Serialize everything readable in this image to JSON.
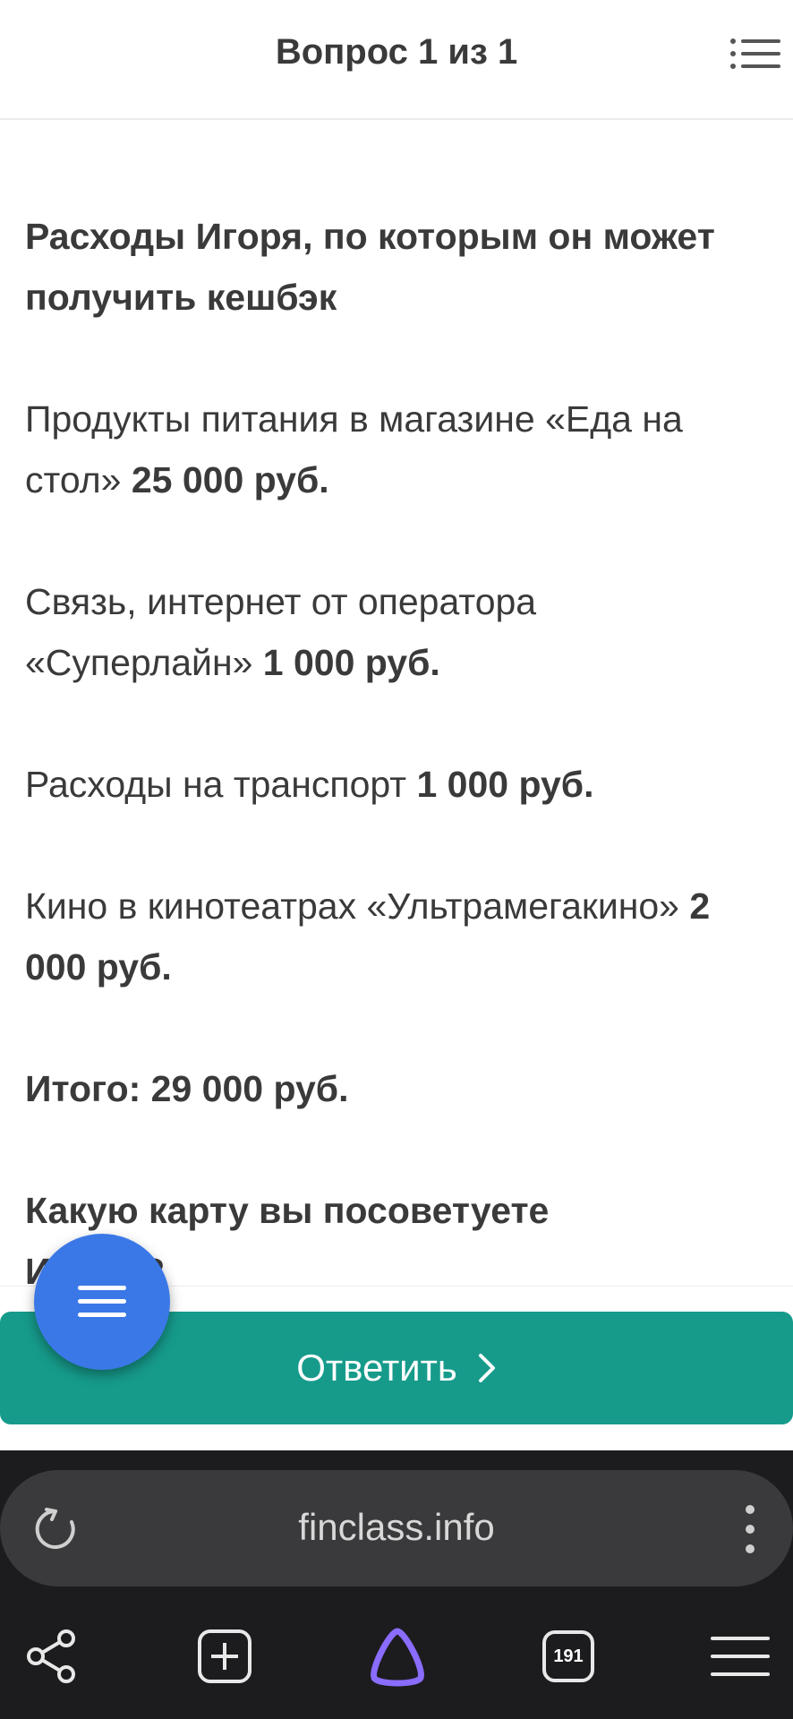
{
  "header": {
    "title": "Вопрос 1 из 1"
  },
  "question": {
    "heading": "Расходы Игоря, по которым он может получить кешбэк",
    "items": [
      {
        "text": "Продукты питания в магазине «Еда на стол» ",
        "amount": "25 000 руб."
      },
      {
        "text": "Связь, интернет от оператора «Суперлайн» ",
        "amount": "1 000 руб."
      },
      {
        "text": "Расходы на транспорт ",
        "amount": "1 000 руб."
      },
      {
        "text": "Кино в кинотеатрах «Ультрамегакино» ",
        "amount": "2 000 руб."
      }
    ],
    "total": "Итого: 29 000 руб.",
    "prompt": "Какую карту вы посоветуете Игорю?"
  },
  "answer_button": {
    "label": "Ответить"
  },
  "browser": {
    "url": "finclass.info",
    "tabs_count": "191"
  },
  "icons": {
    "accent": "#169b8b",
    "fab_color": "#3b78e7",
    "alice_color": "#8a6cff"
  }
}
